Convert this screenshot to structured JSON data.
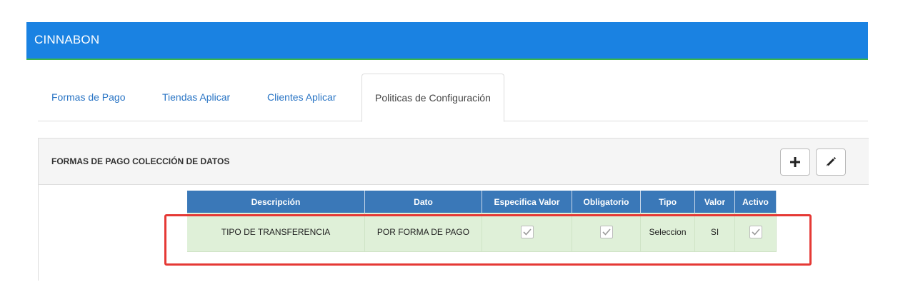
{
  "app": {
    "title": "CINNABON"
  },
  "tabs": [
    {
      "label": "Formas de Pago"
    },
    {
      "label": "Tiendas Aplicar"
    },
    {
      "label": "Clientes Aplicar"
    },
    {
      "label": "Politicas de Configuración",
      "active": true
    }
  ],
  "panel": {
    "title": "FORMAS DE PAGO COLECCIÓN DE DATOS",
    "add_icon": "plus-icon",
    "edit_icon": "pencil-icon"
  },
  "grid": {
    "columns": [
      "Descripción",
      "Dato",
      "Especifica Valor",
      "Obligatorio",
      "Tipo",
      "Valor",
      "Activo"
    ],
    "rows": [
      {
        "descripcion": "TIPO DE TRANSFERENCIA",
        "dato": "POR FORMA DE PAGO",
        "especifica_valor": true,
        "obligatorio": true,
        "tipo": "Seleccion",
        "valor": "SI",
        "activo": true
      }
    ]
  },
  "colors": {
    "topbar": "#1a82e2",
    "topbar_underline": "#3bb54a",
    "tab_link": "#2a75c5",
    "grid_header": "#3a78b8",
    "row_selected": "#dff0d8",
    "highlight": "#e53935"
  }
}
